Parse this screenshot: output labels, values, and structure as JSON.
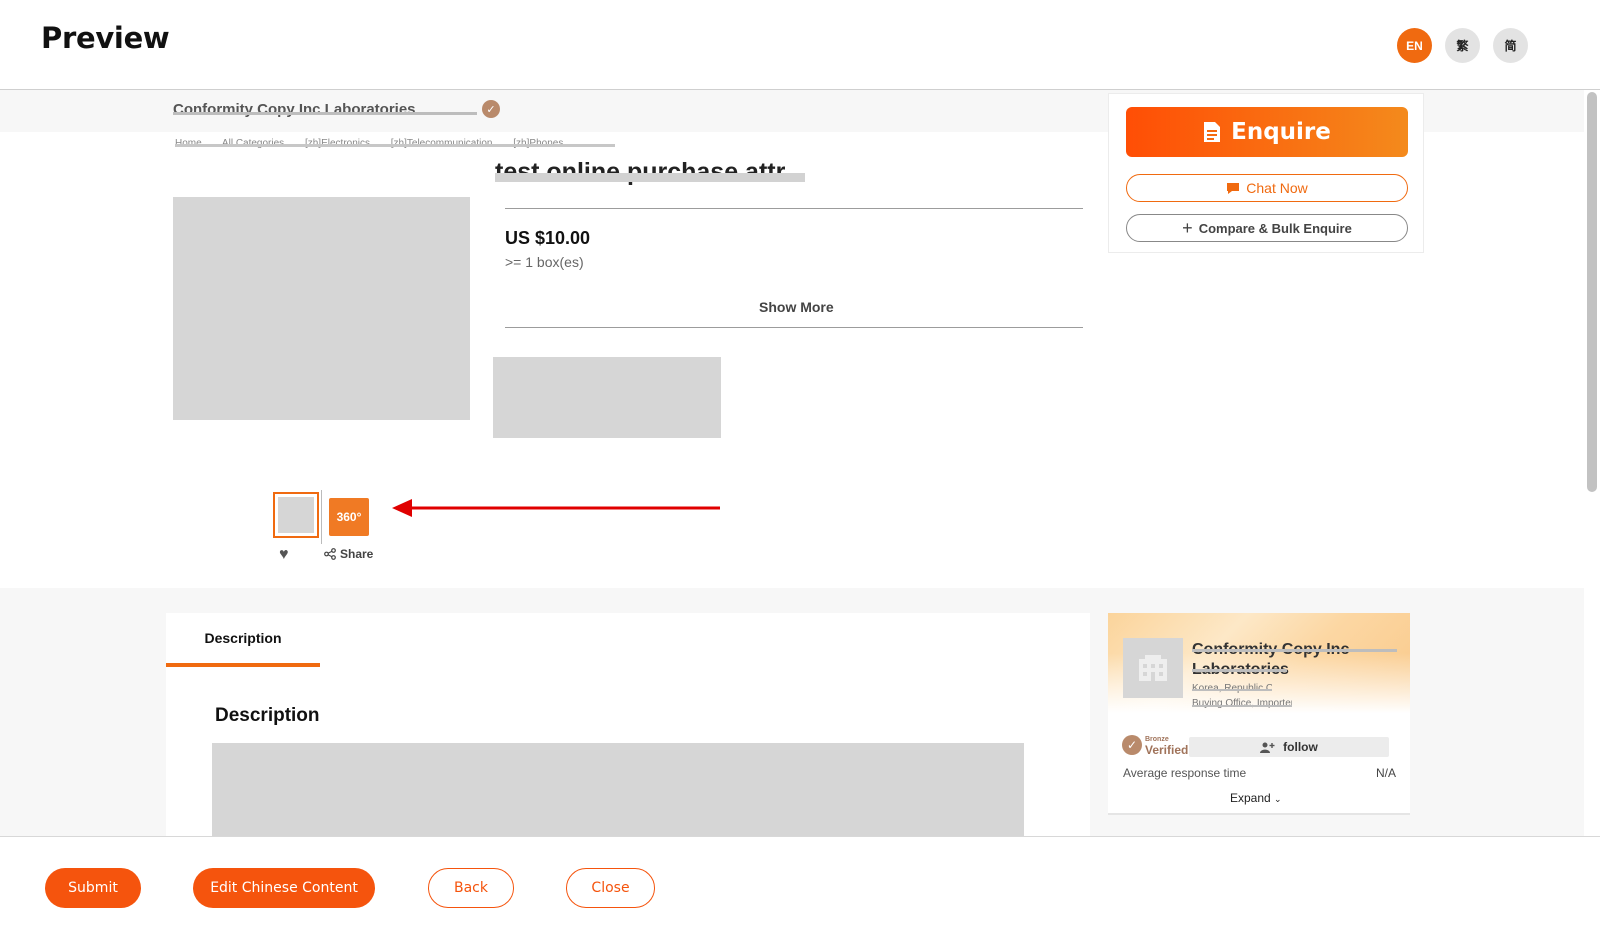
{
  "header": {
    "title": "Preview",
    "languages": [
      {
        "label": "EN",
        "active": true
      },
      {
        "label": "繁",
        "active": false
      },
      {
        "label": "简",
        "active": false
      }
    ]
  },
  "preview": {
    "company_name_redacted": "Conformity Copy Inc Laboratories",
    "breadcrumb": [
      "Home",
      "All Categories",
      "[zh]Electronics",
      "[zh]Telecommunication",
      "[zh]Phones"
    ],
    "product_title": "test online purchase attr",
    "price": "US $10.00",
    "moq": ">= 1 box(es)",
    "show_more_label": "Show More",
    "thumb_360_label": "360°",
    "share_label": "Share"
  },
  "actions": {
    "enquire_label": "Enquire",
    "chat_label": "Chat Now",
    "compare_label": "Compare & Bulk Enquire"
  },
  "tabs": [
    {
      "label": "Description",
      "active": true
    }
  ],
  "description": {
    "heading": "Description"
  },
  "company_card": {
    "name": "Conformity Copy Inc Laboratories",
    "country": "Korea, Republic Of",
    "business_type": "Buying Office, Importer",
    "tier": "Bronze",
    "verified_label": "Verified",
    "follow_label": "follow",
    "response_label": "Average response time",
    "response_value": "N/A",
    "expand_label": "Expand"
  },
  "footer": {
    "submit_label": "Submit",
    "edit_chinese_label": "Edit Chinese Content",
    "back_label": "Back",
    "close_label": "Close"
  },
  "colors": {
    "accent": "#f5540d",
    "enquire_gradient_start": "#ff4e05",
    "enquire_gradient_end": "#f48a1c",
    "placeholder": "#d6d6d6",
    "annotation_arrow": "#e00000"
  }
}
